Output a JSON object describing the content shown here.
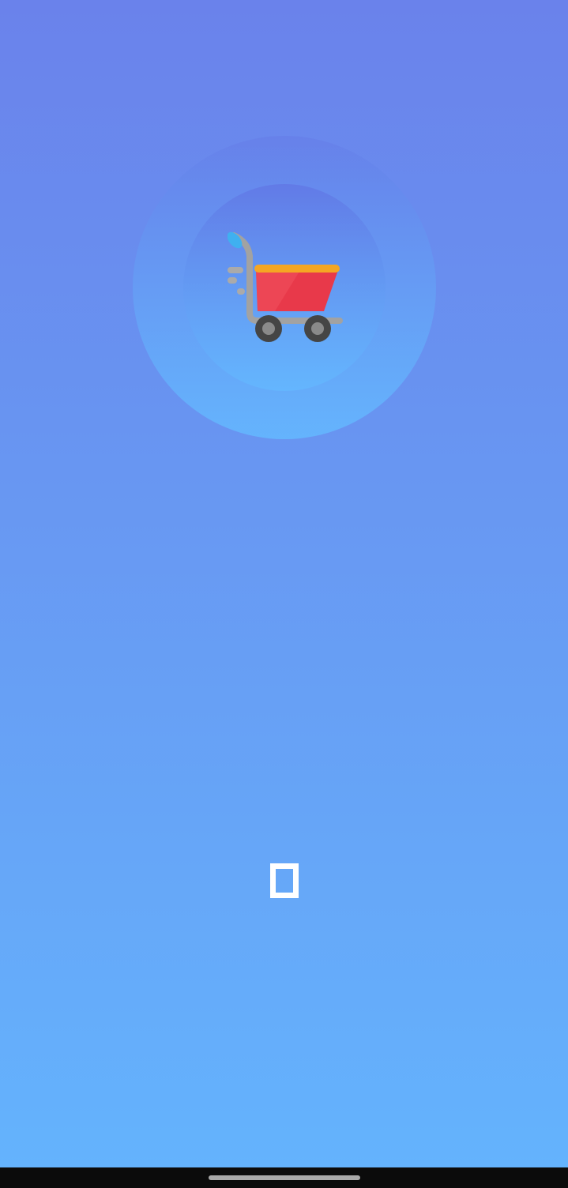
{
  "splash": {
    "logo_icon": "shopping-cart-icon",
    "loader_icon": "loading-indicator"
  },
  "colors": {
    "background_top": "#6a82eb",
    "background_bottom": "#64b3fd",
    "cart_body": "#e8394a",
    "cart_rim": "#f5a623",
    "handle_grip": "#3fb0f0",
    "frame": "#9e9e9e",
    "wheel": "#424242",
    "loader": "#ffffff",
    "navigation_bar": "#0b0b0b"
  },
  "system": {
    "navigation_bar": "gesture-navigation-bar"
  }
}
